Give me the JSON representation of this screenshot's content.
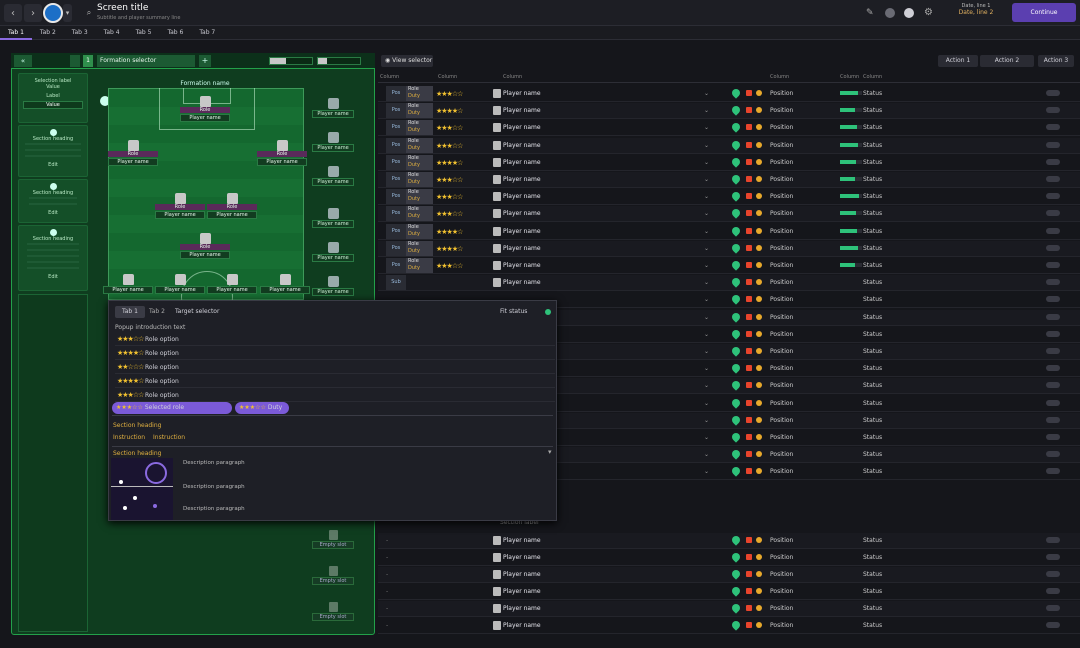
{
  "topbar": {
    "title": "Screen title",
    "subtitle": "Subtitle and player summary line",
    "date_line1": "Date, line 1",
    "date_line2": "Date, line 2",
    "continue_label": "Continue"
  },
  "tabs": [
    {
      "label": "Tab 1"
    },
    {
      "label": "Tab 2"
    },
    {
      "label": "Tab 3"
    },
    {
      "label": "Tab 4"
    },
    {
      "label": "Tab 5"
    },
    {
      "label": "Tab 6"
    },
    {
      "label": "Tab 7"
    }
  ],
  "tactic": {
    "formation_name": "Formation selector",
    "pitch_title": "Formation name",
    "left_box1_title": "Selection label",
    "left_box1_value": "Value",
    "left_box2_label": "Label",
    "left_box2_value": "Value",
    "left_box3_title": "Section heading",
    "left_box4_title": "Section heading",
    "left_box5_title": "Section heading",
    "edit_label": "Edit"
  },
  "pitch_players": [
    {
      "name": "Player name",
      "role": "Role"
    },
    {
      "name": "Player name",
      "role": "Role"
    },
    {
      "name": "Player name",
      "role": "Role"
    },
    {
      "name": "Player name",
      "role": "Role"
    },
    {
      "name": "Player name",
      "role": "Role"
    },
    {
      "name": "Player name",
      "role": "Role"
    },
    {
      "name": "Player name",
      "role": "Role"
    },
    {
      "name": "Player name",
      "role": "Role"
    },
    {
      "name": "Player name",
      "role": "Role"
    },
    {
      "name": "Player name",
      "role": "Role"
    }
  ],
  "subs": [
    {
      "name": "Player name"
    },
    {
      "name": "Player name"
    },
    {
      "name": "Player name"
    },
    {
      "name": "Player name"
    },
    {
      "name": "Player name"
    },
    {
      "name": "Player name"
    }
  ],
  "empty_sub_label": "Empty slot",
  "list": {
    "view_label": "View selector",
    "btn1": "Action 1",
    "btn2": "Action 2",
    "btn3": "Action 3",
    "col_pos": "Column",
    "col_role": "Column",
    "col_player": "Column",
    "col_position": "Column",
    "col_cond": "Column",
    "col_fit": "Column",
    "not_selected": "Section label"
  },
  "players": [
    {
      "slot": "Pos",
      "role": "Role",
      "duty": "Duty",
      "stars": "★★★☆☆",
      "name": "Player name",
      "pos": "Position",
      "cond": 82,
      "fit": "Status"
    },
    {
      "slot": "Pos",
      "role": "Role",
      "duty": "Duty",
      "stars": "★★★★☆",
      "name": "Player name",
      "pos": "Position",
      "cond": 70,
      "fit": "Status"
    },
    {
      "slot": "Pos",
      "role": "Role",
      "duty": "Duty",
      "stars": "★★★☆☆",
      "name": "Player name",
      "pos": "Position",
      "cond": 78,
      "fit": "Status"
    },
    {
      "slot": "Pos",
      "role": "Role",
      "duty": "Duty",
      "stars": "★★★☆☆",
      "name": "Player name",
      "pos": "Position",
      "cond": 80,
      "fit": "Status"
    },
    {
      "slot": "Pos",
      "role": "Role",
      "duty": "Duty",
      "stars": "★★★★☆",
      "name": "Player name",
      "pos": "Position",
      "cond": 74,
      "fit": "Status"
    },
    {
      "slot": "Pos",
      "role": "Role",
      "duty": "Duty",
      "stars": "★★★☆☆",
      "name": "Player name",
      "pos": "Position",
      "cond": 68,
      "fit": "Status"
    },
    {
      "slot": "Pos",
      "role": "Role",
      "duty": "Duty",
      "stars": "★★★☆☆",
      "name": "Player name",
      "pos": "Position",
      "cond": 85,
      "fit": "Status"
    },
    {
      "slot": "Pos",
      "role": "Role",
      "duty": "Duty",
      "stars": "★★★☆☆",
      "name": "Player name",
      "pos": "Position",
      "cond": 72,
      "fit": "Status"
    },
    {
      "slot": "Pos",
      "role": "Role",
      "duty": "Duty",
      "stars": "★★★★☆",
      "name": "Player name",
      "pos": "Position",
      "cond": 77,
      "fit": "Status"
    },
    {
      "slot": "Pos",
      "role": "Role",
      "duty": "Duty",
      "stars": "★★★★☆",
      "name": "Player name",
      "pos": "Position",
      "cond": 81,
      "fit": "Status"
    },
    {
      "slot": "Pos",
      "role": "Role",
      "duty": "Duty",
      "stars": "★★★☆☆",
      "name": "Player name",
      "pos": "Position",
      "cond": 66,
      "fit": "Status"
    },
    {
      "slot": "Sub",
      "role": "",
      "duty": "",
      "stars": "",
      "name": "Player name",
      "pos": "Position",
      "cond": 0,
      "fit": "Status"
    },
    {
      "slot": "",
      "role": "",
      "duty": "",
      "stars": "",
      "name": "",
      "pos": "Position",
      "cond": 0,
      "fit": "Status"
    },
    {
      "slot": "",
      "role": "",
      "duty": "",
      "stars": "",
      "name": "",
      "pos": "Position",
      "cond": 0,
      "fit": "Status"
    },
    {
      "slot": "",
      "role": "",
      "duty": "",
      "stars": "",
      "name": "",
      "pos": "Position",
      "cond": 0,
      "fit": "Status"
    },
    {
      "slot": "",
      "role": "",
      "duty": "",
      "stars": "",
      "name": "",
      "pos": "Position",
      "cond": 0,
      "fit": "Status"
    },
    {
      "slot": "",
      "role": "",
      "duty": "",
      "stars": "",
      "name": "",
      "pos": "Position",
      "cond": 0,
      "fit": "Status"
    },
    {
      "slot": "",
      "role": "",
      "duty": "",
      "stars": "",
      "name": "",
      "pos": "Position",
      "cond": 0,
      "fit": "Status"
    },
    {
      "slot": "",
      "role": "",
      "duty": "",
      "stars": "",
      "name": "",
      "pos": "Position",
      "cond": 0,
      "fit": "Status"
    },
    {
      "slot": "",
      "role": "",
      "duty": "",
      "stars": "",
      "name": "",
      "pos": "Position",
      "cond": 0,
      "fit": "Status"
    },
    {
      "slot": "",
      "role": "",
      "duty": "",
      "stars": "",
      "name": "",
      "pos": "Position",
      "cond": 0,
      "fit": "Status"
    },
    {
      "slot": "",
      "role": "",
      "duty": "",
      "stars": "",
      "name": "",
      "pos": "Position",
      "cond": 0,
      "fit": "Status"
    },
    {
      "slot": "",
      "role": "",
      "duty": "",
      "stars": "",
      "name": "",
      "pos": "Position",
      "cond": 0,
      "fit": "Status"
    }
  ],
  "lower_players": [
    {
      "name": "Player name",
      "pos": "Position",
      "fit": "Status"
    },
    {
      "name": "Player name",
      "pos": "Position",
      "fit": "Status"
    },
    {
      "name": "Player name",
      "pos": "Position",
      "fit": "Status"
    },
    {
      "name": "Player name",
      "pos": "Position",
      "fit": "Status"
    },
    {
      "name": "Player name",
      "pos": "Position",
      "fit": "Status"
    },
    {
      "name": "Player name",
      "pos": "Position",
      "fit": "Status"
    }
  ],
  "popup": {
    "tab1": "Tab 1",
    "tab2": "Tab 2",
    "target": "Target selector",
    "fit_label": "Fit status",
    "intro": "Popup introduction text",
    "roles": [
      {
        "stars": "★★★☆☆",
        "label": "Role option"
      },
      {
        "stars": "★★★★☆",
        "label": "Role option"
      },
      {
        "stars": "★★☆☆☆",
        "label": "Role option"
      },
      {
        "stars": "★★★★☆",
        "label": "Role option"
      },
      {
        "stars": "★★★☆☆",
        "label": "Role option"
      }
    ],
    "selected_role_stars": "★★★☆☆",
    "selected_role": "Selected role",
    "selected_duty_stars": "★★★☆☆",
    "selected_duty": "Duty",
    "instr_title": "Section heading",
    "instr1": "Instruction",
    "instr2": "Instruction",
    "desc_title": "Section heading",
    "desc1": "Description paragraph",
    "desc2": "Description paragraph",
    "desc3": "Description paragraph"
  },
  "colors": {
    "accent": "#5b3fb0",
    "pitch": "#14682f",
    "good": "#2ec27a"
  }
}
